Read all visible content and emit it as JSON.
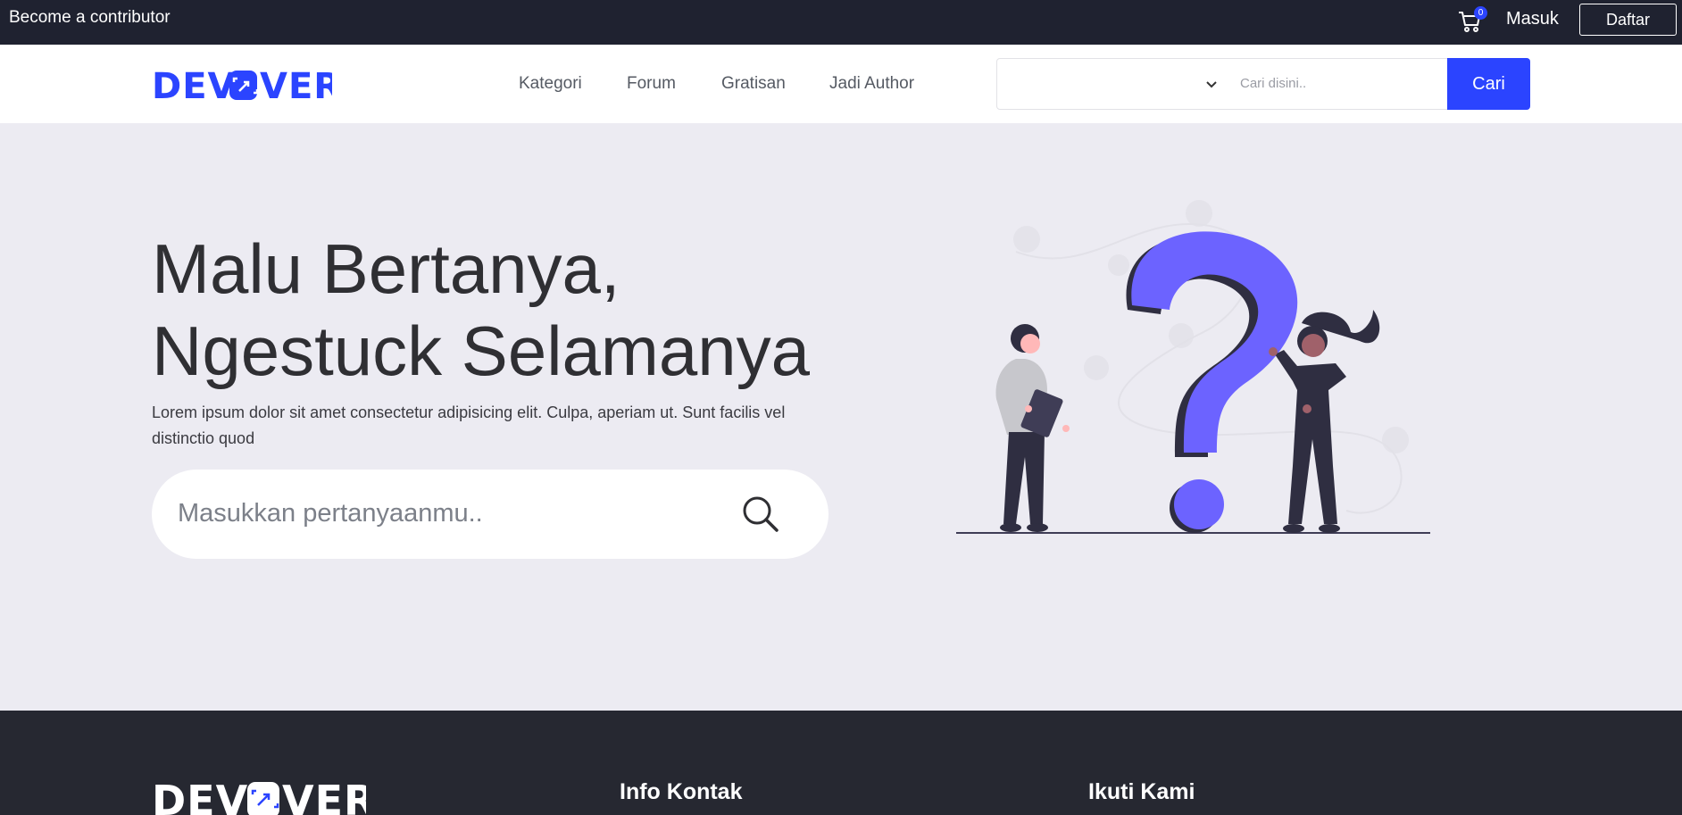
{
  "topbar": {
    "contributor_link": "Become a contributor",
    "cart_count": "0",
    "login_label": "Masuk",
    "register_label": "Daftar"
  },
  "nav": {
    "brand": "DEVOVER",
    "links": [
      "Kategori",
      "Forum",
      "Gratisan",
      "Jadi Author"
    ],
    "search": {
      "category_selected": "",
      "placeholder": "Cari disini..",
      "button_label": "Cari"
    }
  },
  "hero": {
    "title_line1": "Malu Bertanya,",
    "title_line2": "Ngestuck Selamanya",
    "description": "Lorem ipsum dolor sit amet consectetur adipisicing elit. Culpa, aperiam ut. Sunt facilis vel distinctio quod",
    "question_placeholder": "Masukkan pertanyaanmu.."
  },
  "footer": {
    "brand": "DEVOVER",
    "col_contact_title": "Info Kontak",
    "col_follow_title": "Ikuti Kami"
  },
  "colors": {
    "accent": "#2b44ff",
    "topbar": "#1f2230",
    "hero_bg": "#ecebf2",
    "illustration": "#6c63ff"
  }
}
